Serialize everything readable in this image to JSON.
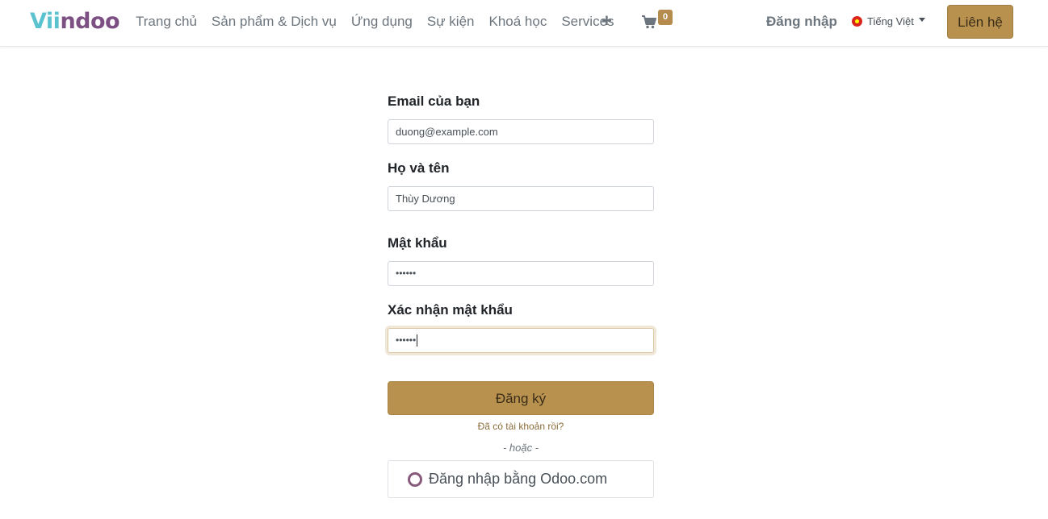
{
  "brand": {
    "logo_prefix": "Vii",
    "logo_suffix": "ndoo",
    "colors": {
      "teal": "#5bc2cf",
      "purple": "#7c5083",
      "gold": "#b8914f"
    }
  },
  "nav": {
    "links": [
      "Trang chủ",
      "Sản phẩm & Dịch vụ",
      "Ứng dụng",
      "Sự kiện",
      "Khoá học",
      "Services"
    ],
    "plus_icon": "plus-icon",
    "cart_count": "0",
    "login": "Đăng nhập",
    "language": "Tiếng Việt",
    "contact": "Liên hệ"
  },
  "form": {
    "email_label": "Email của bạn",
    "email_value": "duong@example.com",
    "name_label": "Họ và tên",
    "name_value": "Thùy Dương",
    "password_label": "Mật khẩu",
    "password_value": "••••••",
    "confirm_label": "Xác nhận mật khẩu",
    "confirm_value": "••••••",
    "submit": "Đăng ký",
    "have_account": "Đã có tài khoản rồi?",
    "or": "- hoặc -",
    "odoo_login": "Đăng nhập bằng Odoo.com"
  }
}
